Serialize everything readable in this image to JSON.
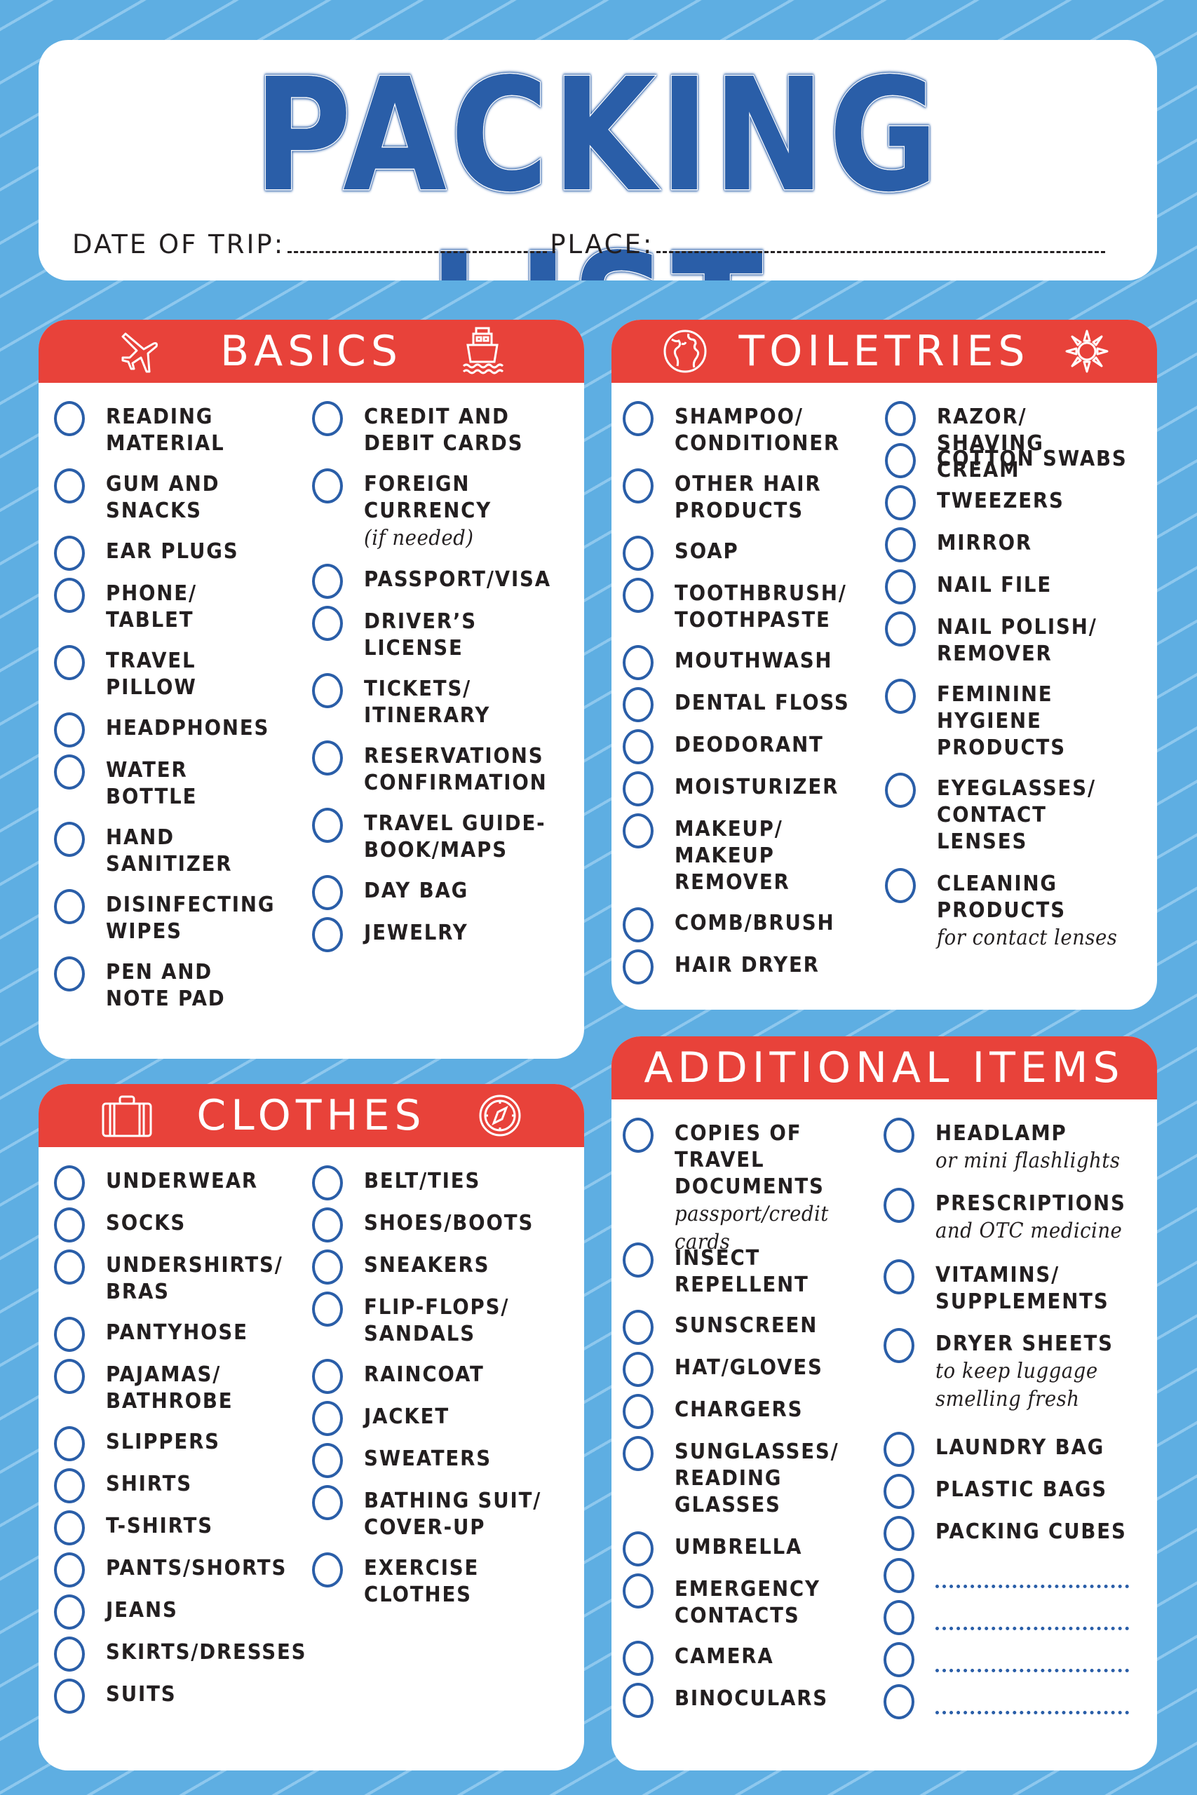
{
  "title": "PACKING LIST",
  "trip": {
    "date_label": "DATE OF TRIP:",
    "place_label": "PLACE:"
  },
  "colors": {
    "background": "#5eaee2",
    "stripe": "#8ec8ee",
    "header_red": "#e8423a",
    "accent_blue": "#2a5ea8",
    "text": "#231f20"
  },
  "sections": {
    "basics": {
      "title": "BASICS",
      "icons": [
        "airplane-icon",
        "ship-icon"
      ],
      "left": [
        {
          "label": "READING\nMATERIAL"
        },
        {
          "label": "GUM AND\nSNACKS"
        },
        {
          "label": "EAR PLUGS"
        },
        {
          "label": "PHONE/\nTABLET"
        },
        {
          "label": "TRAVEL\nPILLOW"
        },
        {
          "label": "HEADPHONES"
        },
        {
          "label": "WATER\nBOTTLE"
        },
        {
          "label": "HAND\nSANITIZER"
        },
        {
          "label": "DISINFECTING\nWIPES"
        },
        {
          "label": "PEN AND\nNOTE PAD"
        }
      ],
      "right": [
        {
          "label": "CREDIT AND\nDEBIT CARDS"
        },
        {
          "label": "FOREIGN\nCURRENCY",
          "note": "(if needed)"
        },
        {
          "label": "PASSPORT/VISA"
        },
        {
          "label": "DRIVER’S\nLICENSE"
        },
        {
          "label": "TICKETS/\nITINERARY"
        },
        {
          "label": "RESERVATIONS\nCONFIRMATION"
        },
        {
          "label": "TRAVEL GUIDE-\nBOOK/MAPS"
        },
        {
          "label": "DAY BAG"
        },
        {
          "label": "JEWELRY"
        }
      ]
    },
    "toiletries": {
      "title": "TOILETRIES",
      "icons": [
        "globe-icon",
        "sun-icon"
      ],
      "left": [
        {
          "label": "SHAMPOO/\nCONDITIONER"
        },
        {
          "label": "OTHER HAIR\nPRODUCTS"
        },
        {
          "label": "SOAP"
        },
        {
          "label": "TOOTHBRUSH/\nTOOTHPASTE"
        },
        {
          "label": "MOUTHWASH"
        },
        {
          "label": "DENTAL FLOSS"
        },
        {
          "label": "DEODORANT"
        },
        {
          "label": "MOISTURIZER"
        },
        {
          "label": "MAKEUP/\nMAKEUP\nREMOVER"
        },
        {
          "label": "COMB/BRUSH"
        },
        {
          "label": "HAIR DRYER"
        }
      ],
      "right": [
        {
          "label": "RAZOR/\nSHAVING CREAM"
        },
        {
          "label": "COTTON SWABS"
        },
        {
          "label": "TWEEZERS"
        },
        {
          "label": "MIRROR"
        },
        {
          "label": "NAIL FILE"
        },
        {
          "label": "NAIL POLISH/\nREMOVER"
        },
        {
          "label": "FEMININE\nHYGIENE\nPRODUCTS"
        },
        {
          "label": "EYEGLASSES/\nCONTACT\nLENSES"
        },
        {
          "label": "CLEANING\nPRODUCTS",
          "note": "for contact lenses"
        }
      ]
    },
    "clothes": {
      "title": "CLOTHES",
      "icons": [
        "suitcase-icon",
        "compass-icon"
      ],
      "left": [
        {
          "label": "UNDERWEAR"
        },
        {
          "label": "SOCKS"
        },
        {
          "label": "UNDERSHIRTS/\nBRAS"
        },
        {
          "label": "PANTYHOSE"
        },
        {
          "label": "PAJAMAS/\nBATHROBE"
        },
        {
          "label": "SLIPPERS"
        },
        {
          "label": "SHIRTS"
        },
        {
          "label": "T-SHIRTS"
        },
        {
          "label": "PANTS/SHORTS"
        },
        {
          "label": "JEANS"
        },
        {
          "label": "SKIRTS/DRESSES"
        },
        {
          "label": "SUITS"
        }
      ],
      "right": [
        {
          "label": "BELT/TIES"
        },
        {
          "label": "SHOES/BOOTS"
        },
        {
          "label": "SNEAKERS"
        },
        {
          "label": "FLIP-FLOPS/\nSANDALS"
        },
        {
          "label": "RAINCOAT"
        },
        {
          "label": "JACKET"
        },
        {
          "label": "SWEATERS"
        },
        {
          "label": "BATHING SUIT/\nCOVER-UP"
        },
        {
          "label": "EXERCISE\nCLOTHES"
        }
      ]
    },
    "additional": {
      "title": "ADDITIONAL ITEMS",
      "left": [
        {
          "label": "COPIES OF\nTRAVEL\nDOCUMENTS",
          "note": "passport/credit cards"
        },
        {
          "label": "INSECT\nREPELLENT"
        },
        {
          "label": "SUNSCREEN"
        },
        {
          "label": "HAT/GLOVES"
        },
        {
          "label": "CHARGERS"
        },
        {
          "label": "SUNGLASSES/\nREADING\nGLASSES"
        },
        {
          "label": "UMBRELLA"
        },
        {
          "label": "EMERGENCY\nCONTACTS"
        },
        {
          "label": "CAMERA"
        },
        {
          "label": "BINOCULARS"
        }
      ],
      "right": [
        {
          "label": "HEADLAMP",
          "note": "or mini flashlights"
        },
        {
          "label": "PRESCRIPTIONS",
          "note": "and OTC medicine"
        },
        {
          "label": "VITAMINS/\nSUPPLEMENTS"
        },
        {
          "label": "DRYER SHEETS",
          "note": "to keep luggage\nsmelling fresh"
        },
        {
          "label": "LAUNDRY BAG"
        },
        {
          "label": "PLASTIC BAGS"
        },
        {
          "label": "PACKING CUBES"
        },
        {
          "label": "",
          "blank": true
        },
        {
          "label": "",
          "blank": true
        },
        {
          "label": "",
          "blank": true
        },
        {
          "label": "",
          "blank": true
        }
      ]
    }
  }
}
